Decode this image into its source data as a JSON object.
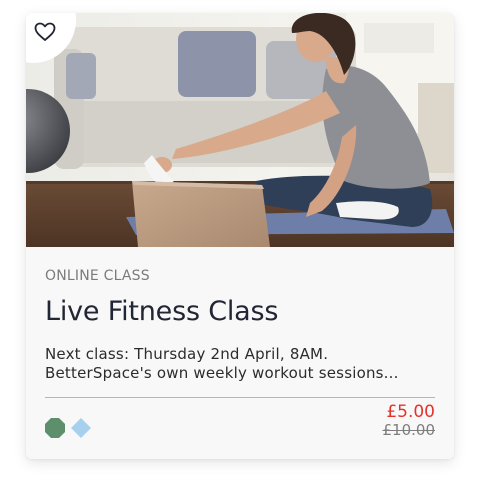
{
  "card": {
    "image_description": "hero-photo",
    "favourite_icon": "heart-outline-icon",
    "eyebrow": "ONLINE CLASS",
    "title": "Live Fitness Class",
    "description_line1": "Next class: Thursday 2nd April, 8AM.",
    "description_line2": "BetterSpace's own weekly workout sessions...",
    "tags": [
      {
        "icon": "octagon-icon",
        "color": "#5e8f6d"
      },
      {
        "icon": "diamond-icon",
        "color": "#a7d0ef"
      }
    ],
    "price": {
      "current": "£5.00",
      "original": "£10.00",
      "current_color": "#e2342d"
    }
  }
}
